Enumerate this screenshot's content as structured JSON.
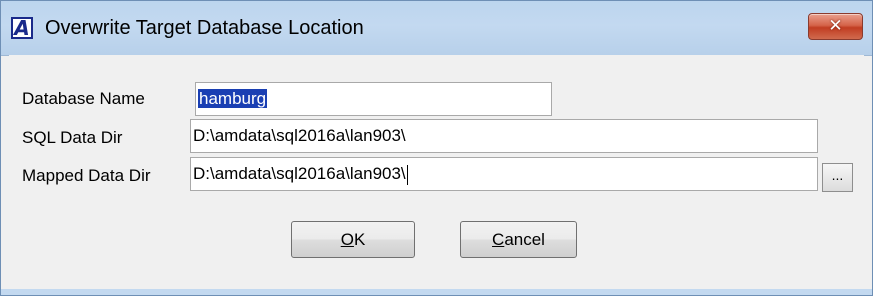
{
  "window": {
    "title": "Overwrite Target Database Location",
    "icon": "A",
    "close_label": "✕"
  },
  "form": {
    "database_name": {
      "label": "Database Name",
      "value": "hamburg"
    },
    "sql_data_dir": {
      "label": "SQL Data Dir",
      "value": "D:\\amdata\\sql2016a\\lan903\\"
    },
    "mapped_data_dir": {
      "label": "Mapped Data Dir",
      "value": "D:\\amdata\\sql2016a\\lan903\\",
      "browse_label": "..."
    }
  },
  "buttons": {
    "ok_mnemonic": "O",
    "ok_rest": "K",
    "cancel_mnemonic": "C",
    "cancel_rest": "ancel"
  }
}
